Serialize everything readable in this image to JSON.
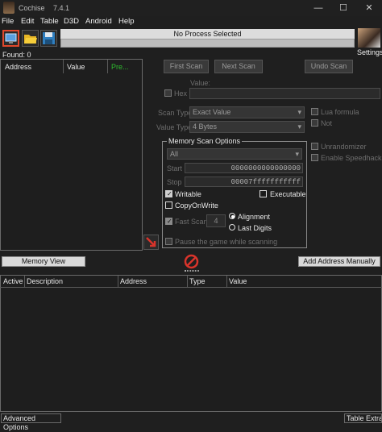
{
  "window": {
    "title": "Cochise",
    "version": "7.4.1",
    "controls": {
      "minimize": "—",
      "maximize": "☐",
      "close": "✕"
    }
  },
  "menu": [
    "File",
    "Edit",
    "Table",
    "D3D",
    "Android",
    "Help"
  ],
  "toolbar": {
    "process_text": "No Process Selected",
    "settings_label": "Settings",
    "icons": [
      "computer-icon",
      "open-folder-icon",
      "save-icon"
    ]
  },
  "results": {
    "found_label": "Found: 0",
    "columns": [
      "Address",
      "Value",
      "Pre..."
    ]
  },
  "scan": {
    "first_scan": "First Scan",
    "next_scan": "Next Scan",
    "undo_scan": "Undo Scan",
    "value_label": "Value:",
    "hex_label": "Hex",
    "scan_type_label": "Scan Type",
    "scan_type_value": "Exact Value",
    "value_type_label": "Value Type",
    "value_type_value": "4 Bytes",
    "lua_formula": "Lua formula",
    "not_label": "Not"
  },
  "memory": {
    "title": "Memory Scan Options",
    "region": "All",
    "start_label": "Start",
    "start_value": "0000000000000000",
    "stop_label": "Stop",
    "stop_value": "00007fffffffffff",
    "writable": "Writable",
    "executable": "Executable",
    "copy_on_write": "CopyOnWrite",
    "fast_scan": "Fast Scan",
    "fast_scan_value": "4",
    "alignment": "Alignment",
    "last_digits": "Last Digits",
    "pause_game": "Pause the game while scanning"
  },
  "extra": {
    "unrandomizer": "Unrandomizer",
    "enable_speedhack": "Enable Speedhack"
  },
  "buttons": {
    "memory_view": "Memory View",
    "add_address": "Add Address Manually"
  },
  "address_list": {
    "columns": [
      "Active",
      "Description",
      "Address",
      "Type",
      "Value"
    ]
  },
  "footer": {
    "advanced_options": "Advanced Options",
    "table_extras": "Table Extras"
  },
  "colors": {
    "accent_red": "#d9342b",
    "prev_column": "#2fbf2f",
    "highlight_border": "#e0482c"
  }
}
